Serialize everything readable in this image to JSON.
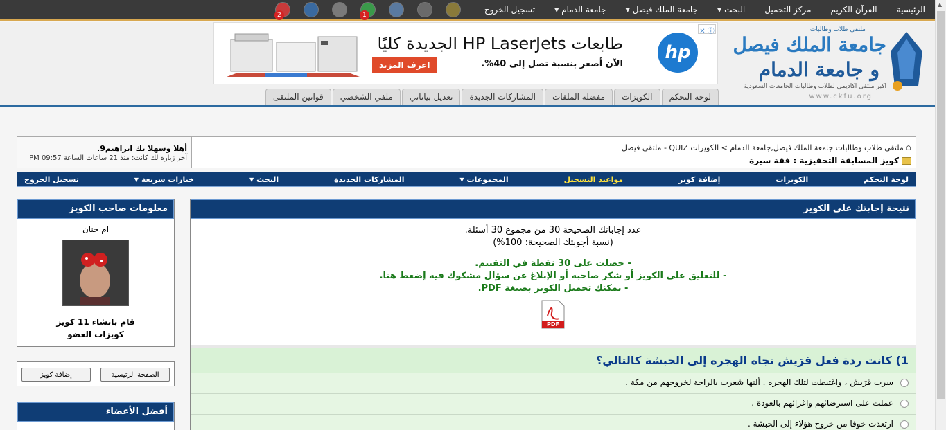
{
  "topbar": {
    "links": [
      {
        "label": "الرئيسية",
        "caret": false
      },
      {
        "label": "القرآن الكريم",
        "caret": false
      },
      {
        "label": "مركز التحميل",
        "caret": false
      },
      {
        "label": "البحث",
        "caret": true
      },
      {
        "label": "جامعة الملك فيصل",
        "caret": true
      },
      {
        "label": "جامعة الدمام",
        "caret": true
      },
      {
        "label": "تسجيل الخروج",
        "caret": false
      }
    ],
    "icons": [
      {
        "name": "stats-icon",
        "color": "#8a7a3a",
        "badge": ""
      },
      {
        "name": "pin-icon",
        "color": "#6a6a6a",
        "badge": ""
      },
      {
        "name": "globe-icon",
        "color": "#5a7aa0",
        "badge": ""
      },
      {
        "name": "messages-icon",
        "color": "#3a9a4a",
        "badge": "1"
      },
      {
        "name": "settings-icon",
        "color": "#7a7a7a",
        "badge": ""
      },
      {
        "name": "profile-icon",
        "color": "#3a6aa0",
        "badge": ""
      },
      {
        "name": "notifications-icon",
        "color": "#c83a3a",
        "badge": "2"
      }
    ]
  },
  "logo": {
    "top": "ملتقى طلاب وطالبات",
    "line1": "جامعة الملك فيصل",
    "line1b": "و جامعة الدمام",
    "tagline": "اكبر ملتقى اكاديمي لطلاب وطالبات الجامعات السعودية",
    "url": "www.ckfu.org"
  },
  "ad": {
    "close": "ⓘ ✕",
    "brand": "hp",
    "headline": "طابعات HP LaserJets الجديدة كليًا",
    "sub": "الآن أصغر بنسبة تصل إلى 40%.",
    "cta": "اعرف المزيد"
  },
  "tabs": [
    "لوحة التحكم",
    "الكويزات",
    "مفضلة الملفات",
    "المشاركات الجديدة",
    "تعديل بياناتي",
    "ملفي الشخصي",
    "قوانين الملتقى"
  ],
  "crumbs": {
    "path": "ملتقى طلاب وطالبات جامعة الملك فيصل,جامعة الدمام > الكويزات QUIZ - ملتقى فيصل",
    "title": "كويز المسابقة التحفيزية : فقة سيرة",
    "welcome": "أهلا وسهلا بك ابراهيم9.",
    "lastvisit": "آخر زيارة لك كانت: منذ 21 ساعات الساعة 09:57 PM"
  },
  "bluenav": [
    {
      "label": "لوحة التحكم",
      "caret": false,
      "hi": false
    },
    {
      "label": "الكويزات",
      "caret": false,
      "hi": false
    },
    {
      "label": "إضافة كويز",
      "caret": false,
      "hi": false
    },
    {
      "label": "مواعيد التسجيل",
      "caret": false,
      "hi": true
    },
    {
      "label": "المجموعات",
      "caret": true,
      "hi": false
    },
    {
      "label": "المشاركات الجديدة",
      "caret": false,
      "hi": false
    },
    {
      "label": "البحث",
      "caret": true,
      "hi": false
    },
    {
      "label": "خيارات سريعة",
      "caret": true,
      "hi": false
    },
    {
      "label": "تسجيل الخروج",
      "caret": false,
      "hi": false
    }
  ],
  "author": {
    "header": "معلومات صاحب الكويز",
    "name": "ام حنان",
    "created": "قام بانشاء 11 كويز",
    "quizzes": "كويزات العضو"
  },
  "buttons": {
    "home": "الصفحة الرئيسية",
    "add": "إضافة كويز"
  },
  "best": {
    "header": "أفضل الأعضاء"
  },
  "result": {
    "header": "نتيجة إجابتك على الكويز",
    "line1": "عدد إجاباتك الصحيحة 30 من مجموع 30 أسئلة.",
    "line2": "(نسبة أجوبتك الصحيحة: 100%)",
    "g1": "- حصلت على 30 نقطة في التقييم.",
    "g2": "- للتعليق على الكويز أو شكر صاحبه أو الإبلاغ عن سؤال مشكوك فيه إضغط هنا.",
    "g3": "- يمكنك تحميل الكويز بصيغة PDF.",
    "pdf": "PDF"
  },
  "question": {
    "title": "1) كانت ردة فعل قرَيش تجاه الهجره إلى الحبشة كالتالي؟",
    "answers": [
      "سرت قرَيش ، واغتبطت لتلك الهجره . ألنها شعرت بالراحة لخروجهم من مكة .",
      "عملت على استرضائهم واغرائهم بالعودة .",
      "ارتعدت خوفا من خروج هؤلاء إلى الحبشة ."
    ]
  }
}
